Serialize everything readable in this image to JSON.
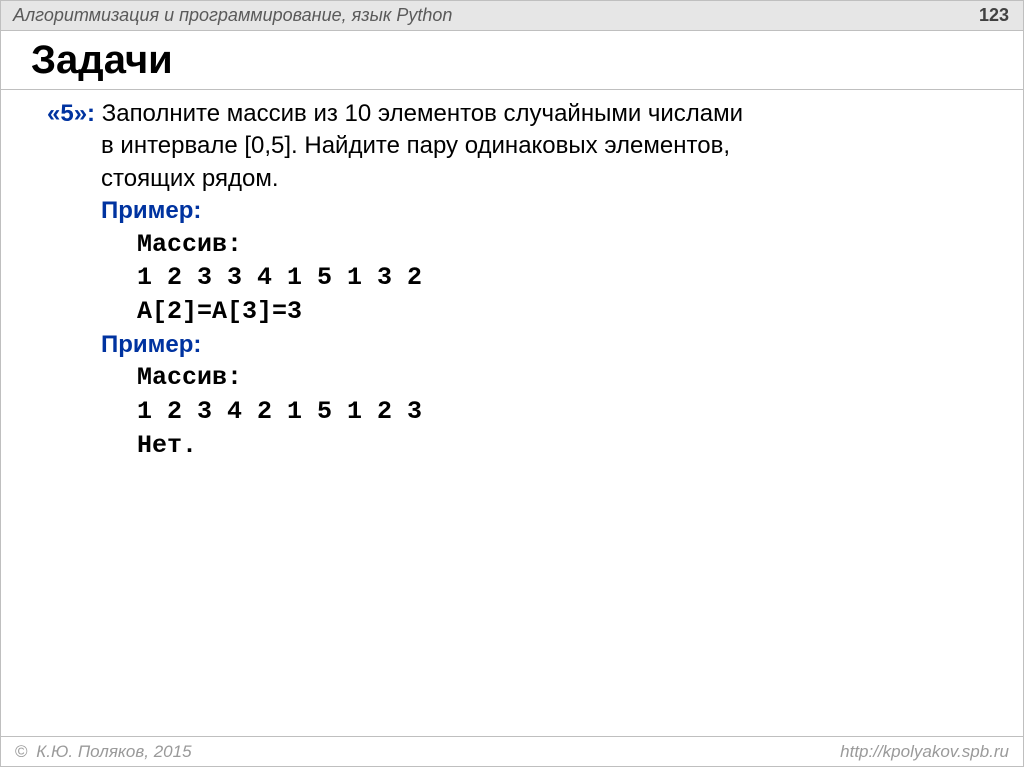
{
  "header": {
    "title": "Алгоритмизация и программирование, язык Python",
    "page": "123"
  },
  "title": "Задачи",
  "task": {
    "grade": "«5»:",
    "text_line1": "Заполните массив из 10 элементов случайными числами",
    "text_line2": "в интервале [0,5]. Найдите пару одинаковых элементов,",
    "text_line3": "стоящих рядом."
  },
  "example1": {
    "label": "Пример:",
    "arr_label": "Массив:",
    "arr_values": "1 2 3 3 4 1 5 1 3 2",
    "result": "A[2]=A[3]=3"
  },
  "example2": {
    "label": "Пример:",
    "arr_label": "Массив:",
    "arr_values": "1 2 3 4 2 1 5 1 2 3",
    "result": "Нет."
  },
  "footer": {
    "left": "К.Ю. Поляков, 2015",
    "right": "http://kpolyakov.spb.ru"
  }
}
